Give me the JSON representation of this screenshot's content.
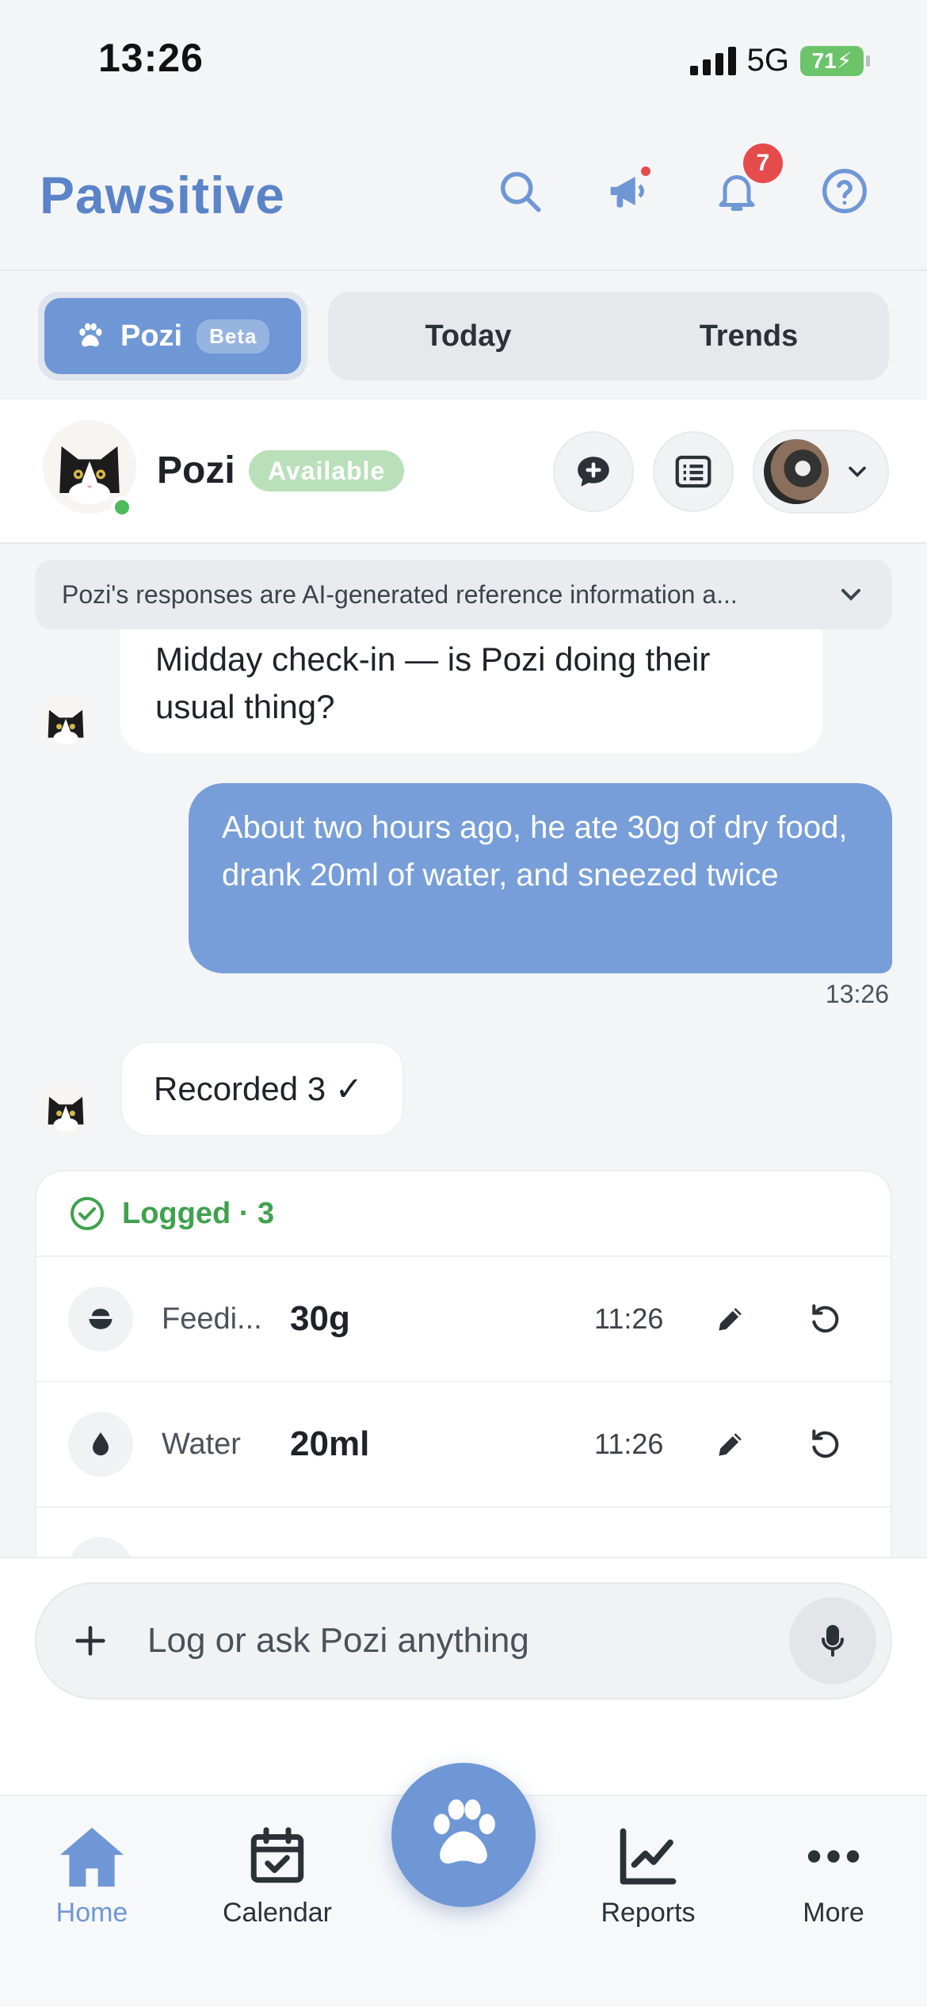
{
  "status_bar": {
    "time": "13:26",
    "network": "5G",
    "battery": "71"
  },
  "header": {
    "brand": "Pawsitive",
    "notification_count": "7"
  },
  "tabs": {
    "pozi": "Pozi",
    "pozi_badge": "Beta",
    "today": "Today",
    "trends": "Trends"
  },
  "chat_header": {
    "name": "Pozi",
    "status": "Available"
  },
  "disclaimer": "Pozi's responses are AI-generated reference information a...",
  "messages": {
    "m1": "Midday check-in — is Pozi doing their usual thing?",
    "m2": "About two hours ago, he ate 30g of dry food, drank 20ml of water, and sneezed twice",
    "m2_time": "13:26",
    "m3": "Recorded 3 ✓"
  },
  "logged": {
    "title": "Logged · 3",
    "rows": [
      {
        "type": "Feedi...",
        "value": "30g",
        "time": "11:26",
        "icon": "bowl-icon"
      },
      {
        "type": "Water",
        "value": "20ml",
        "time": "11:26",
        "icon": "water-drop-icon"
      }
    ]
  },
  "composer": {
    "placeholder": "Log or ask Pozi anything"
  },
  "nav": {
    "home": "Home",
    "calendar": "Calendar",
    "reports": "Reports",
    "more": "More"
  },
  "colors": {
    "accent": "#6f97d6",
    "brand": "#5b84c8",
    "success": "#3fa14d",
    "alert": "#e54b4b"
  }
}
